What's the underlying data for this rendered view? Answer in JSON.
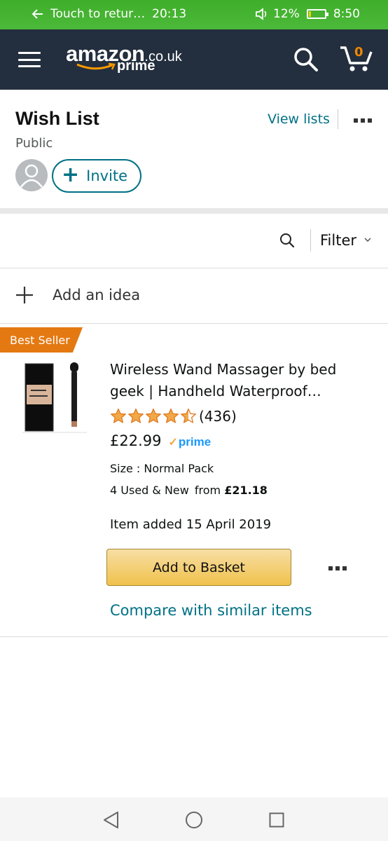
{
  "status_bar": {
    "back_text": "Touch to retur…",
    "call_time": "20:13",
    "battery": "12%",
    "battery_level": 0.12,
    "clock": "8:50"
  },
  "header": {
    "logo_word": "amazon",
    "logo_tld": ".co.uk",
    "logo_prime": "prime",
    "cart_count": "0"
  },
  "wishlist": {
    "title": "Wish List",
    "visibility": "Public",
    "view_lists": "View lists",
    "invite": "Invite"
  },
  "toolbar": {
    "filter": "Filter",
    "add_idea": "Add an idea"
  },
  "item": {
    "badge": "Best Seller",
    "title": "Wireless Wand Massager by bed geek | Handheld Waterproof…",
    "rating": 4.5,
    "rating_count": "(436)",
    "price": "£22.99",
    "prime": "prime",
    "size": "Size : Normal Pack",
    "used_new": "4 Used & New",
    "from_label": "from",
    "from_price": "£21.18",
    "added": "Item added 15 April 2019",
    "add_to_basket": "Add to Basket",
    "compare": "Compare with similar items"
  },
  "colors": {
    "header_bg": "#232f3e",
    "link": "#007185",
    "badge": "#e47911",
    "star": "#f3a847",
    "button": "#f0c14b"
  }
}
